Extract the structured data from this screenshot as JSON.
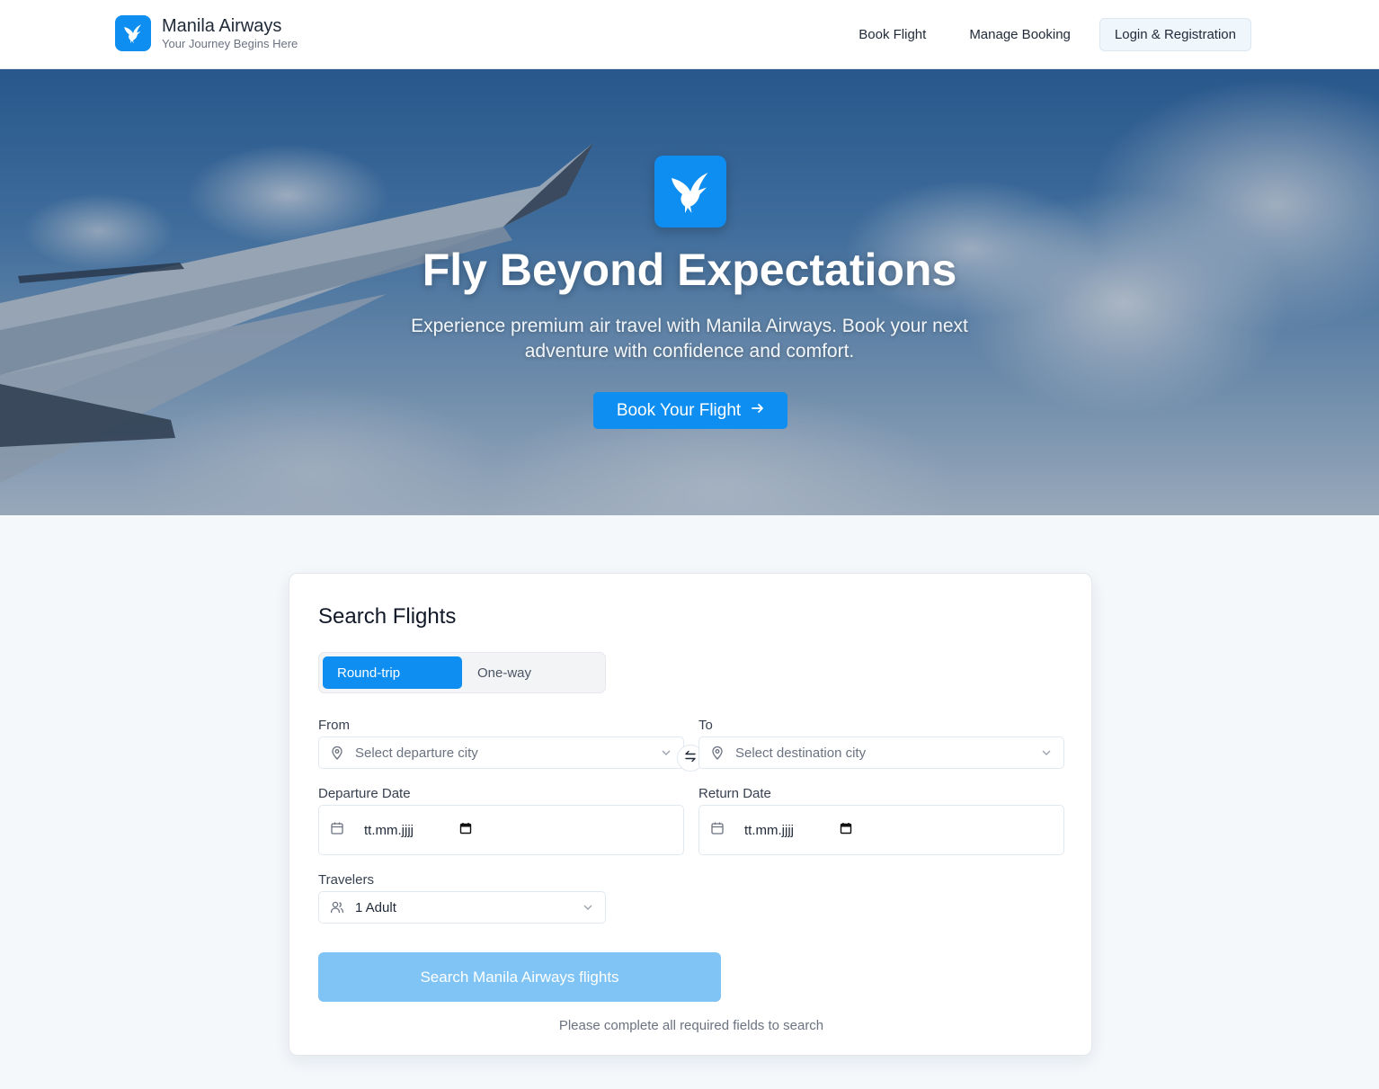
{
  "brand": {
    "name": "Manila Airways",
    "tagline": "Your Journey Begins Here"
  },
  "nav": {
    "book_flight": "Book Flight",
    "manage_booking": "Manage Booking",
    "login": "Login & Registration"
  },
  "hero": {
    "title": "Fly Beyond Expectations",
    "subtitle": "Experience premium air travel with Manila Airways. Book your next adventure with confidence and comfort.",
    "cta_label": "Book Your Flight",
    "cta_icon": "arrow-right-icon"
  },
  "search": {
    "title": "Search Flights",
    "trip_types": [
      "Round-trip",
      "One-way"
    ],
    "selected_trip_type": "Round-trip",
    "from": {
      "label": "From",
      "placeholder": "Select departure city"
    },
    "to": {
      "label": "To",
      "placeholder": "Select destination city"
    },
    "departure_date": {
      "label": "Departure Date",
      "value": "tt.mm.jjjj"
    },
    "return_date": {
      "label": "Return Date",
      "value": "tt.mm.jjjj"
    },
    "travelers": {
      "label": "Travelers",
      "value": "1 Adult"
    },
    "submit_label": "Search Manila Airways flights",
    "hint": "Please complete all required fields to search"
  },
  "colors": {
    "accent": "#0e8ef0",
    "disabled_button": "#7fc4f5",
    "page_background": "#f4f8fb"
  }
}
